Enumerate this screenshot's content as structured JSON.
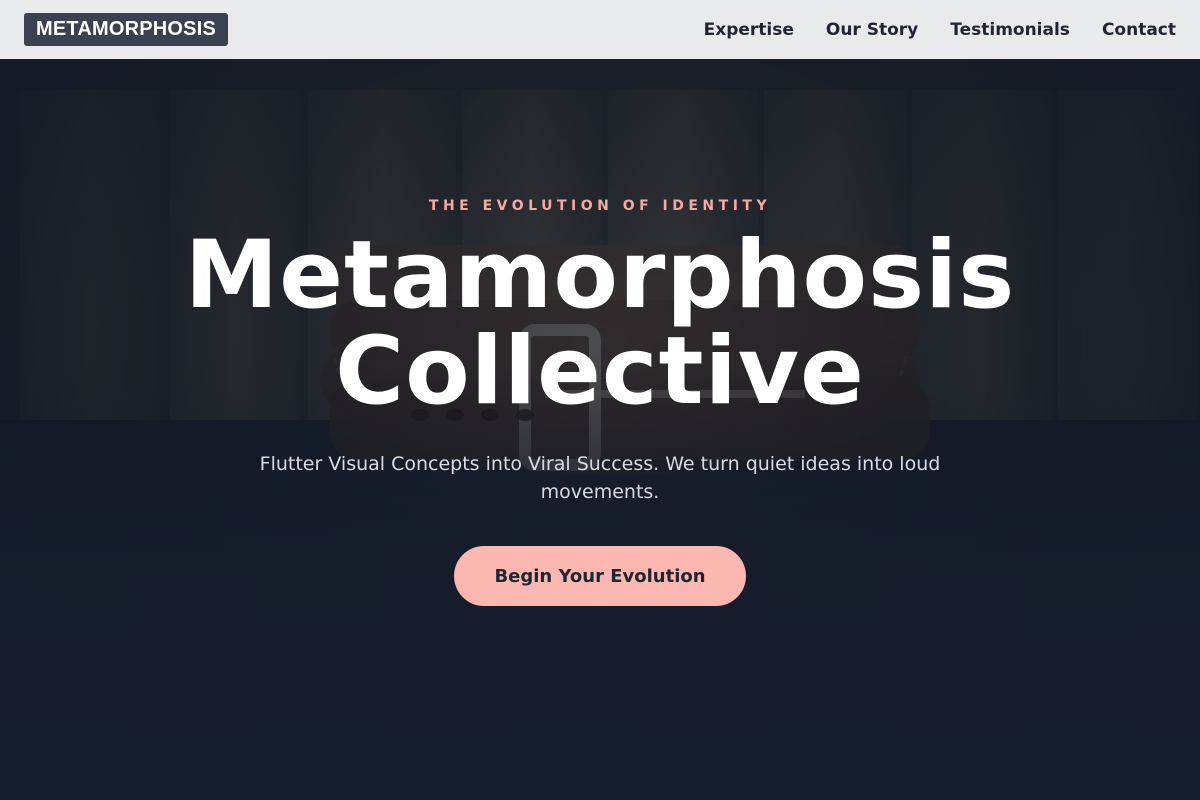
{
  "nav": {
    "logo": "METAMORPHOSIS",
    "links": [
      "Expertise",
      "Our Story",
      "Testimonials",
      "Contact"
    ]
  },
  "hero": {
    "eyebrow": "THE EVOLUTION OF IDENTITY",
    "title_line1": "Metamorphosis",
    "title_line2": "Collective",
    "subtitle": "Flutter Visual Concepts into Viral Success. We turn quiet ideas into loud movements.",
    "cta_label": "Begin Your Evolution"
  },
  "colors": {
    "nav_bg": "#e9eaec",
    "logo_bg": "#3a4252",
    "hero_bg": "#161d2c",
    "accent": "#f5a9a3",
    "cta_bg": "#fdb7b1"
  }
}
